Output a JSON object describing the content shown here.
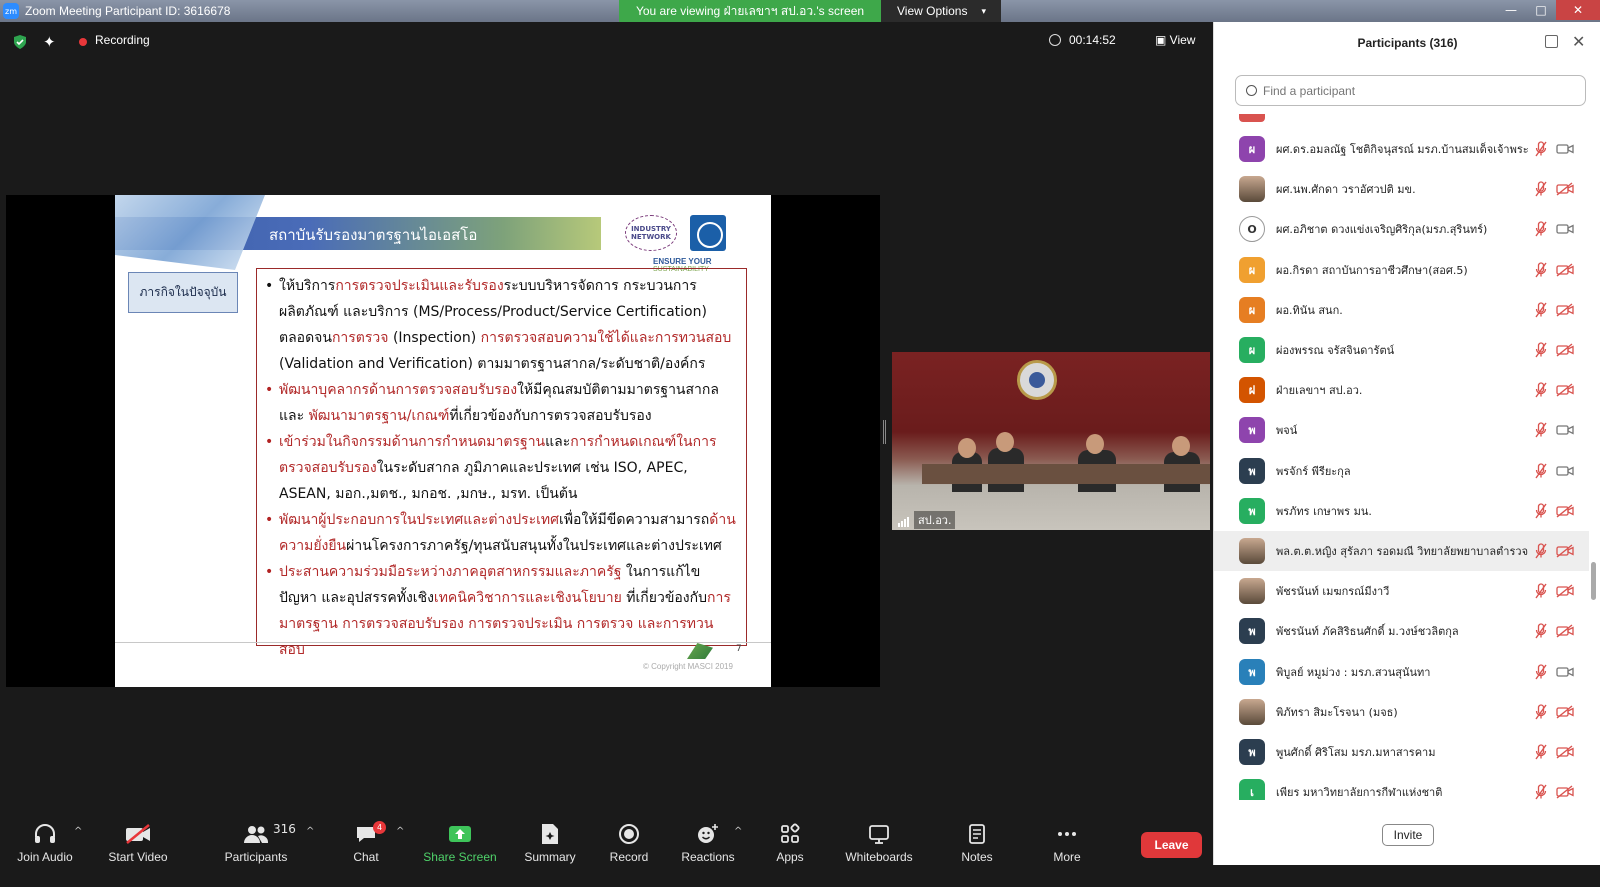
{
  "window": {
    "title": "Zoom Meeting Participant ID: 3616678",
    "viewing_banner": "You are viewing ฝ่ายเลขาฯ สป.อว.'s screen",
    "view_options": "View Options",
    "buttons": {
      "minimize": "—",
      "maximize": "□",
      "close": "✕"
    }
  },
  "topbar": {
    "recording": "Recording",
    "timer": "00:14:52",
    "view": "View"
  },
  "slide": {
    "title": "สถาบันรับรองมาตรฐานไอเอสโอ",
    "logo_industry": "INDUSTRY NETWORK",
    "ensure": "ENSURE YOUR",
    "ensure_sub": "SUSTAINABILITY",
    "side_box": "ภารกิจในปัจจุบัน",
    "bullets": [
      {
        "parts": [
          {
            "t": "ให้บริการ",
            "red": false
          },
          {
            "t": "การตรวจประเมินและรับรอง",
            "red": true
          },
          {
            "t": "ระบบบริหารจัดการ กระบวนการ ผลิตภัณฑ์ และบริการ (MS/Process/Product/Service Certification) ตลอดจน",
            "red": false
          },
          {
            "t": "การตรวจ",
            "red": true
          },
          {
            "t": " (Inspection) ",
            "red": false
          },
          {
            "t": "การตรวจสอบความใช้ได้และการทวนสอบ",
            "red": true
          },
          {
            "t": " (Validation and Verification) ตามมาตรฐานสากล/ระดับชาติ/องค์กร",
            "red": false
          }
        ]
      },
      {
        "parts": [
          {
            "t": "พัฒนาบุคลากรด้านการตรวจสอบรับรอง",
            "red": true
          },
          {
            "t": "ให้มีคุณสมบัติตามมาตรฐานสากล และ ",
            "red": false
          },
          {
            "t": "พัฒนามาตรฐาน/เกณฑ์",
            "red": true
          },
          {
            "t": "ที่เกี่ยวข้องกับการตรวจสอบรับรอง",
            "red": false
          }
        ]
      },
      {
        "parts": [
          {
            "t": "เข้าร่วมในกิจกรรมด้านการกำหนดมาตรฐาน",
            "red": true
          },
          {
            "t": "และ",
            "red": false
          },
          {
            "t": "การกำหนดเกณฑ์ในการตรวจสอบรับรอง",
            "red": true
          },
          {
            "t": "ในระดับสากล ภูมิภาคและประเทศ เช่น ISO, APEC, ASEAN, มอก.,มตช., มกอช. ,มกษ., มรท. เป็นต้น",
            "red": false
          }
        ]
      },
      {
        "parts": [
          {
            "t": "พัฒนาผู้ประกอบการในประเทศและต่างประเทศ",
            "red": true
          },
          {
            "t": "เพื่อให้มีขีดความสามารถ",
            "red": false
          },
          {
            "t": "ด้านความยั่งยืน",
            "red": true
          },
          {
            "t": "ผ่านโครงการภาครัฐ/ทุนสนับสนุนทั้งในประเทศและต่างประเทศ",
            "red": false
          }
        ]
      },
      {
        "parts": [
          {
            "t": "ประสานความร่วมมือระหว่างภาคอุตสาหกรรมและภาครัฐ",
            "red": true
          },
          {
            "t": " ในการแก้ไขปัญหา และอุปสรรคทั้งเชิง",
            "red": false
          },
          {
            "t": "เทคนิควิชาการและเชิงนโยบาย",
            "red": true
          },
          {
            "t": " ที่เกี่ยวข้องกับ",
            "red": false
          },
          {
            "t": "การมาตรฐาน การตรวจสอบรับรอง การตรวจประเมิน การตรวจ และการทวนสอบ",
            "red": true
          }
        ]
      }
    ],
    "page_number": "7",
    "copyright": "© Copyright MASCI 2019"
  },
  "video": {
    "label": "สป.อว."
  },
  "toolbar": {
    "items": [
      {
        "label": "Join Audio",
        "icon": "headphones-icon"
      },
      {
        "label": "Start Video",
        "icon": "video-off-icon"
      },
      {
        "label": "Participants",
        "icon": "participants-icon"
      },
      {
        "label": "Chat",
        "icon": "chat-icon"
      },
      {
        "label": "Share Screen",
        "icon": "share-screen-icon"
      },
      {
        "label": "Summary",
        "icon": "summary-icon"
      },
      {
        "label": "Record",
        "icon": "record-icon"
      },
      {
        "label": "Reactions",
        "icon": "reactions-icon"
      },
      {
        "label": "Apps",
        "icon": "apps-icon"
      },
      {
        "label": "Whiteboards",
        "icon": "whiteboard-icon"
      },
      {
        "label": "Notes",
        "icon": "notes-icon"
      },
      {
        "label": "More",
        "icon": "more-icon"
      }
    ],
    "participant_count": "316",
    "chat_badge": "4",
    "leave": "Leave"
  },
  "panel": {
    "title": "Participants (316)",
    "search_placeholder": "Find a participant",
    "invite": "Invite",
    "participants": [
      {
        "initial": "ผ",
        "color": "#8e44ad",
        "name": "ผศ.ดร.อมลณัฐ โชติกิจนุสรณ์ มรภ.บ้านสมเด็จเจ้าพระยา",
        "cam": "on"
      },
      {
        "initial": "",
        "color": "",
        "name": "ผศ.นพ.ศักดา วราอัศวปติ มข.",
        "cam": "off"
      },
      {
        "initial": "O",
        "color": "#ffffff",
        "name": "ผศ.อภิชาต ดวงแข่งเจริญศิริกุล(มรภ.สุรินทร์)",
        "cam": "on"
      },
      {
        "initial": "ผ",
        "color": "#f0a030",
        "name": "ผอ.กิรดา สถาบันการอาชีวศึกษา(สอศ.5)",
        "cam": "off"
      },
      {
        "initial": "ผ",
        "color": "#e67e22",
        "name": "ผอ.ทินัน สนก.",
        "cam": "off"
      },
      {
        "initial": "ผ",
        "color": "#27ae60",
        "name": "ผ่องพรรณ จรัสจินดารัตน์",
        "cam": "off"
      },
      {
        "initial": "ฝ",
        "color": "#d35400",
        "name": "ฝ่ายเลขาฯ สป.อว.",
        "cam": "off"
      },
      {
        "initial": "พ",
        "color": "#8e44ad",
        "name": "พจน์",
        "cam": "on"
      },
      {
        "initial": "พ",
        "color": "#2c3e50",
        "name": "พรจักร์ พีรียะกุล",
        "cam": "on"
      },
      {
        "initial": "พ",
        "color": "#27ae60",
        "name": "พรภัทร เกษาพร มน.",
        "cam": "off"
      },
      {
        "initial": "",
        "color": "",
        "name": "พล.ต.ต.หญิง สุรัลภา รอดมณี วิทยาลัยพยาบาลตำรวจ",
        "cam": "off"
      },
      {
        "initial": "",
        "color": "",
        "name": "พัชรนันท์ เมฆกรณ์มีงาวี",
        "cam": "off"
      },
      {
        "initial": "พ",
        "color": "#2c3e50",
        "name": "พัชรนันท์ ภัคสิริธนศักดิ์ ม.วงษ์ชวลิตกุล",
        "cam": "off"
      },
      {
        "initial": "พ",
        "color": "#2980b9",
        "name": "พิบูลย์ หมูม่วง : มรภ.สวนสุนันทา",
        "cam": "on"
      },
      {
        "initial": "",
        "color": "",
        "name": "พิภัทรา สิมะโรจนา (มจธ)",
        "cam": "off"
      },
      {
        "initial": "พ",
        "color": "#2c3e50",
        "name": "พูนศักดิ์ ศิริโสม มรภ.มหาสารคาม",
        "cam": "off"
      },
      {
        "initial": "เ",
        "color": "#27ae60",
        "name": "เพียร มหาวิทยาลัยการกีฬาแห่งชาติ",
        "cam": "off"
      }
    ]
  }
}
